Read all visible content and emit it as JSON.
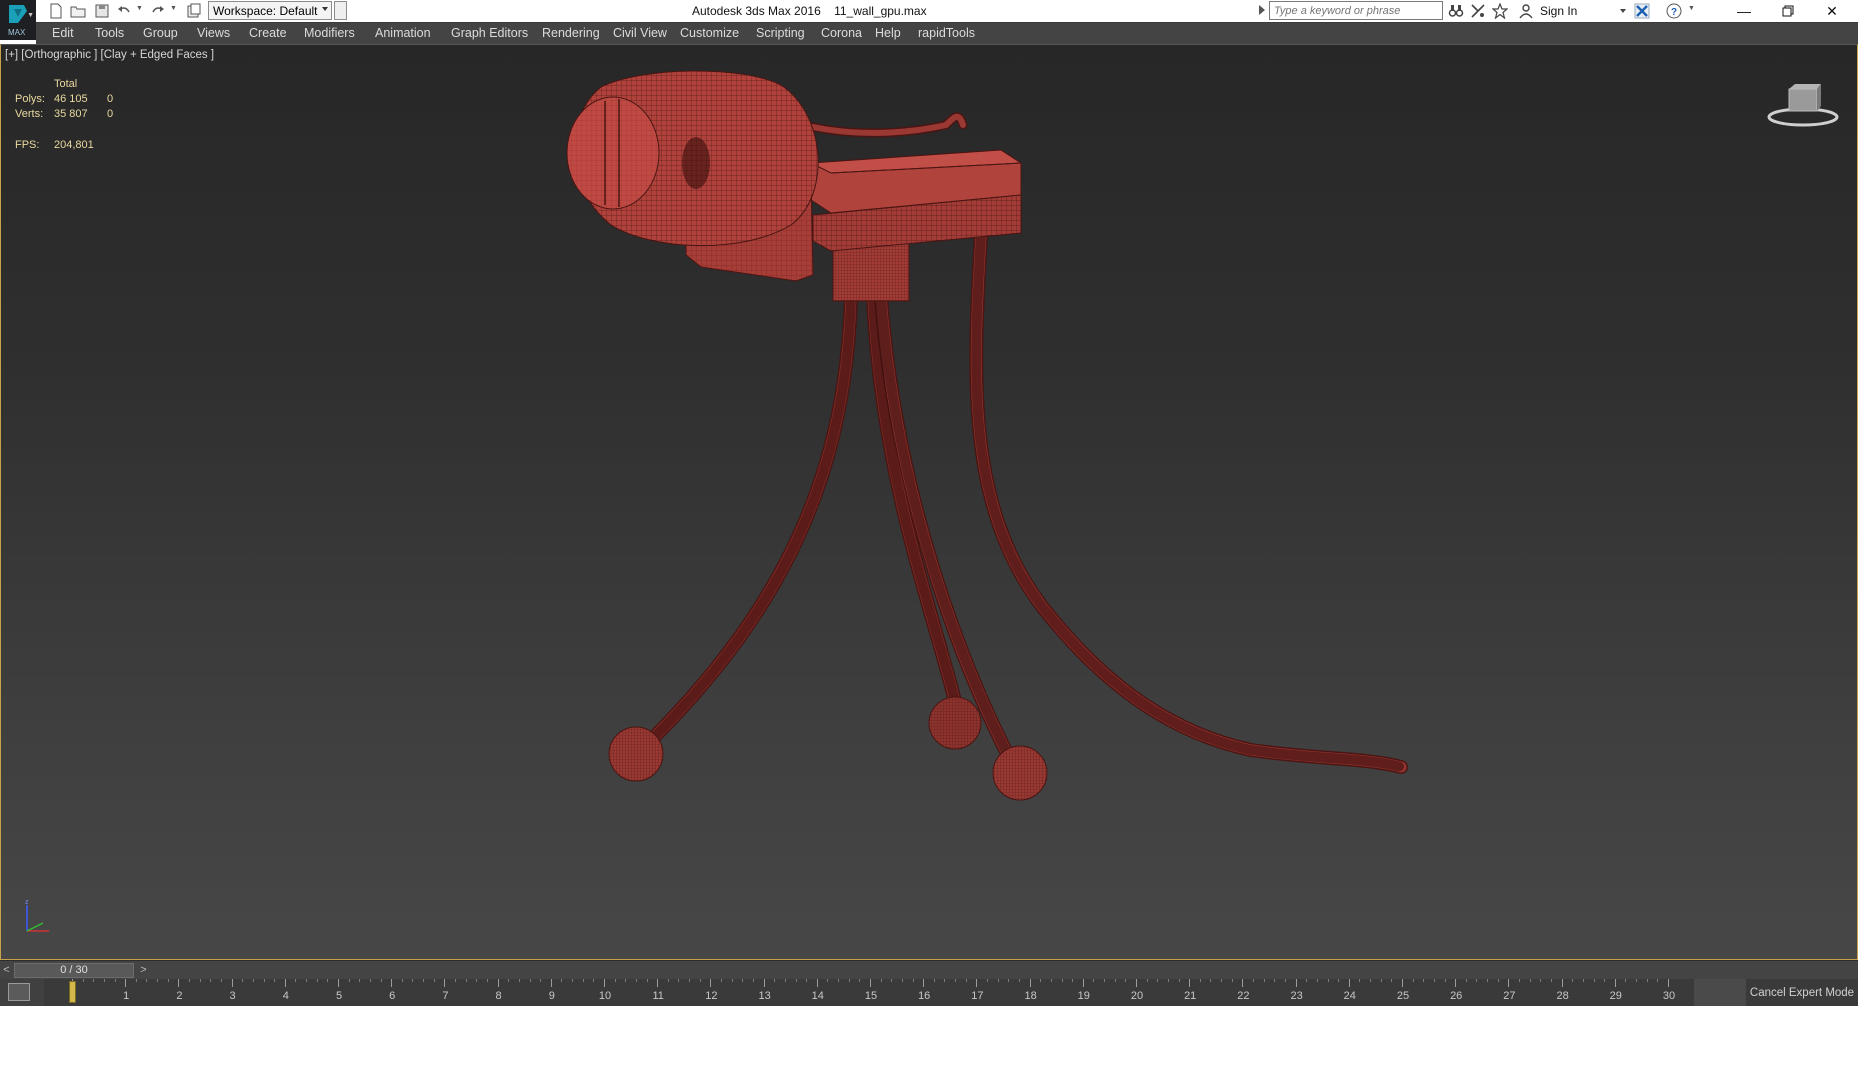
{
  "app": {
    "title": "Autodesk 3ds Max 2016",
    "file": "11_wall_gpu.max",
    "logo_text": "MAX"
  },
  "quick_access": {
    "workspace_value": "Workspace: Default",
    "search_placeholder": "Type a keyword or phrase",
    "sign_in": "Sign In",
    "icons": [
      "new-icon",
      "open-icon",
      "save-icon",
      "undo-icon",
      "redo-icon",
      "project-icon",
      "binoculars-icon",
      "subscription-icon",
      "favorites-icon",
      "user-icon",
      "exchange-icon",
      "help-icon"
    ]
  },
  "menu": [
    "Edit",
    "Tools",
    "Group",
    "Views",
    "Create",
    "Modifiers",
    "Animation",
    "Graph Editors",
    "Rendering",
    "Civil View",
    "Customize",
    "Scripting",
    "Corona",
    "Help",
    "rapidTools"
  ],
  "viewport": {
    "label": "[+] [Orthographic ] [Clay + Edged Faces ]",
    "stats": {
      "header": "Total",
      "polys_label": "Polys:",
      "polys_total": "46 105",
      "polys_sel": "0",
      "verts_label": "Verts:",
      "verts_total": "35 807",
      "verts_sel": "0",
      "fps_label": "FPS:",
      "fps_value": "204,801"
    },
    "model_color": "#a8403a",
    "wire_color": "#4a1512"
  },
  "timeline": {
    "frame_display": "0 / 30",
    "prev": "<",
    "next": ">",
    "ticks": [
      "0",
      "1",
      "2",
      "3",
      "4",
      "5",
      "6",
      "7",
      "8",
      "9",
      "10",
      "11",
      "12",
      "13",
      "14",
      "15",
      "16",
      "17",
      "18",
      "19",
      "20",
      "21",
      "22",
      "23",
      "24",
      "25",
      "26",
      "27",
      "28",
      "29",
      "30"
    ],
    "current_frame": 0,
    "total_frames": 30,
    "cancel_expert": "Cancel Expert Mode"
  }
}
